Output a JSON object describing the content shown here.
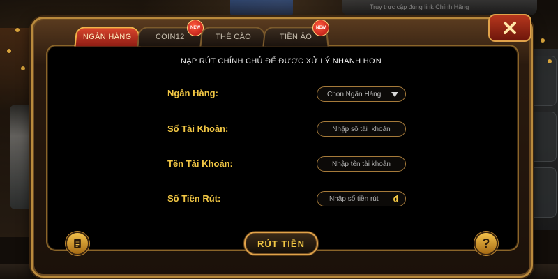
{
  "tabs": [
    {
      "label": "NGÂN HÀNG",
      "active": true
    },
    {
      "label": "COIN12",
      "badge": "NEW"
    },
    {
      "label": "THẺ CÀO"
    },
    {
      "label": "TIỀN ẢO",
      "badge": "NEW"
    }
  ],
  "headline": "NẠP RÚT CHÍNH CHỦ ĐỂ ĐƯỢC XỬ LÝ NHANH HƠN",
  "form": {
    "bank_label": "Ngân Hàng:",
    "bank_select": "Chọn Ngân Hàng",
    "account_number_label": "Số Tài Khoản:",
    "account_number_placeholder": "Nhập số tài  khoản",
    "account_name_label": "Tên Tài Khoản:",
    "account_name_placeholder": "Nhập tên tài khoản",
    "amount_label": "Số Tiền Rút:",
    "amount_placeholder": "Nhập số tiền rút",
    "currency_symbol": "đ"
  },
  "withdraw_button": "RÚT TIỀN",
  "help_button": "?",
  "background": {
    "top_banner_text": "Truy trực cập đúng link Chính Hãng"
  }
}
